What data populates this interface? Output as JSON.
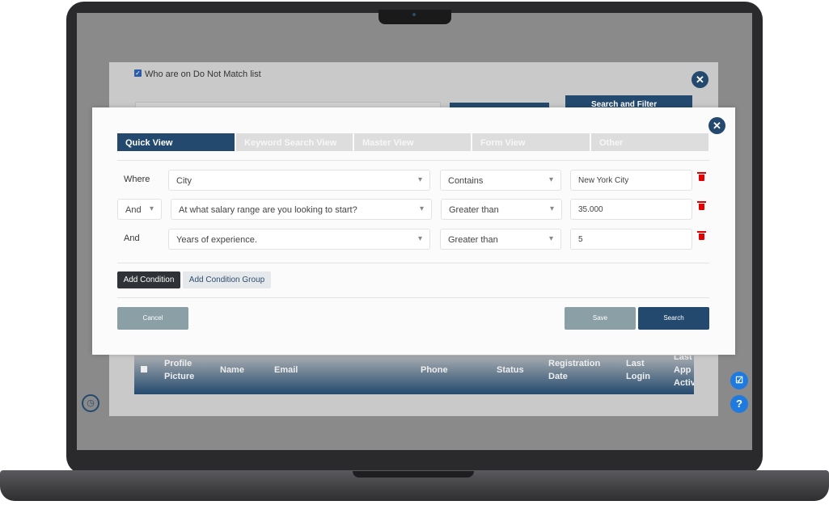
{
  "background_dialog": {
    "checkbox_label": "Who are on Do Not Match list",
    "checkbox_checked": true,
    "search_filter_label": "Search and Filter",
    "table_headers": [
      "Profile Picture",
      "Name",
      "Email",
      "Phone",
      "Status",
      "Registration Date",
      "Last Login",
      "Last App Activity"
    ]
  },
  "modal": {
    "tabs": [
      {
        "label": "Quick View",
        "active": true
      },
      {
        "label": "Keyword Search View",
        "active": false
      },
      {
        "label": "Master View",
        "active": false
      },
      {
        "label": "Form View",
        "active": false
      },
      {
        "label": "Other",
        "active": false
      }
    ],
    "conditions": [
      {
        "connector": "Where",
        "field": "City",
        "operator": "Contains",
        "value": "New York City"
      },
      {
        "connector": "And",
        "field": "At what salary range are you looking to start?",
        "operator": "Greater than",
        "value": "35.000"
      },
      {
        "connector": "And",
        "field": "Years of experience.",
        "operator": "Greater than",
        "value": "5"
      }
    ],
    "add_condition": "Add Condition",
    "add_condition_group": "Add Condition Group",
    "cancel": "Cancel",
    "save": "Save",
    "search": "Search"
  },
  "colors": {
    "primary": "#234a6e",
    "danger": "#e30000",
    "muted_button": "#8aa0a6",
    "fab": "#1f7ae0"
  }
}
